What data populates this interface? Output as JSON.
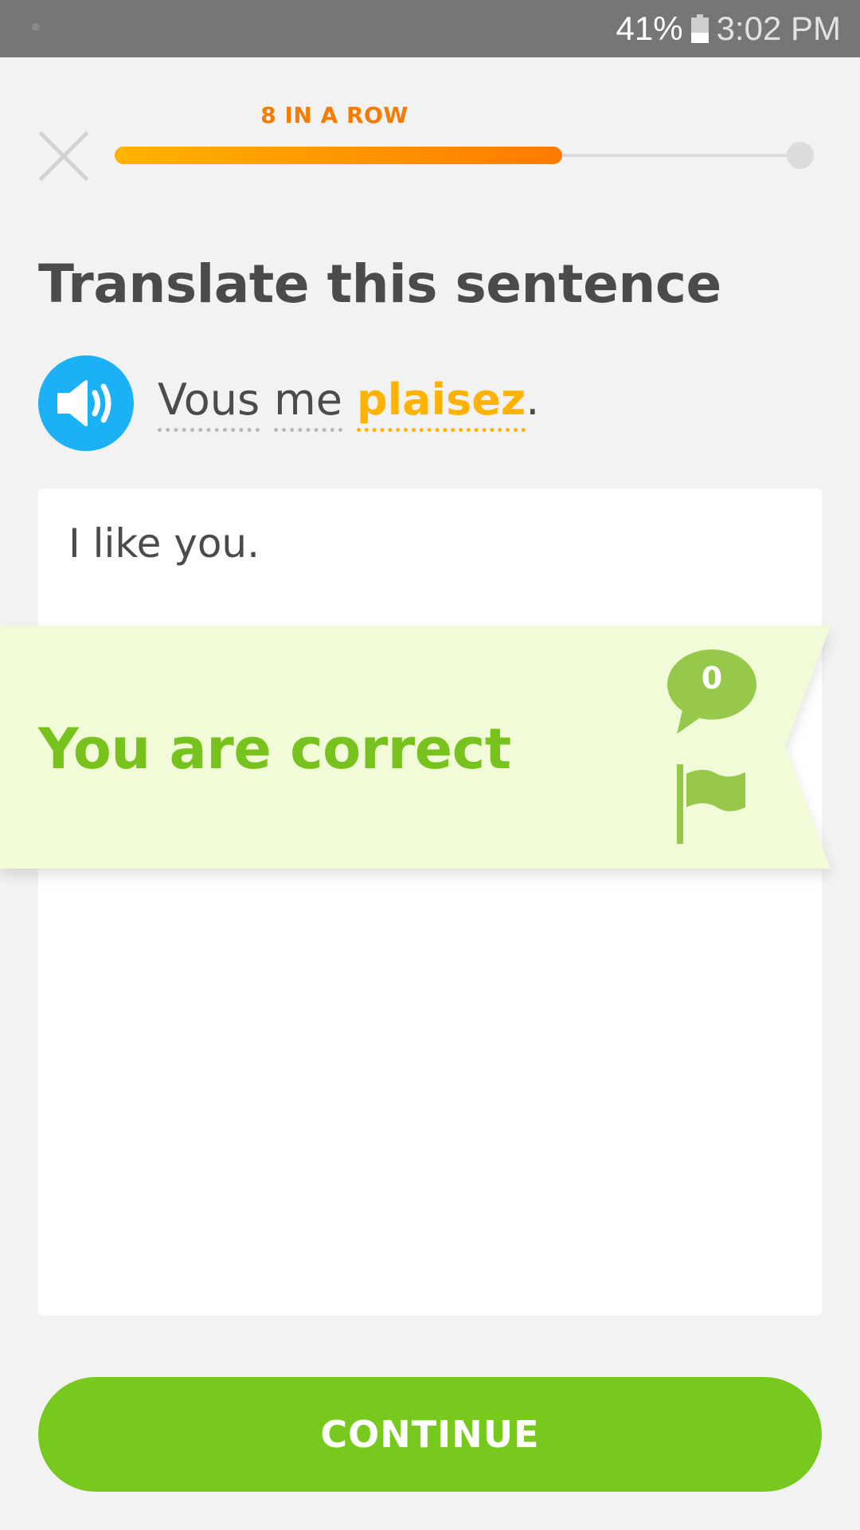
{
  "status_bar": {
    "battery_percent": "41%",
    "battery_level": 0.41,
    "time": "3:02 PM"
  },
  "lesson": {
    "streak_label": "8 IN A ROW",
    "progress_fraction": 0.64,
    "instruction": "Translate this sentence",
    "sentence_words": [
      {
        "text": "Vous",
        "is_new": false
      },
      {
        "text": "me",
        "is_new": false
      },
      {
        "text": "plaisez",
        "is_new": true
      }
    ],
    "sentence_end": ".",
    "answer": "I like you."
  },
  "feedback": {
    "message": "You are correct",
    "discussion_count": "0"
  },
  "continue_label": "CONTINUE",
  "colors": {
    "brand_green": "#78c91e",
    "correct_text": "#78c21d",
    "banner_bg": "#f1fbd8",
    "streak_orange": "#f57c00",
    "new_word_yellow": "#ffb300",
    "speaker_blue": "#1cb0f6"
  },
  "icons": [
    "close-icon",
    "speaker-icon",
    "discussion-bubble-icon",
    "flag-icon",
    "battery-icon"
  ]
}
